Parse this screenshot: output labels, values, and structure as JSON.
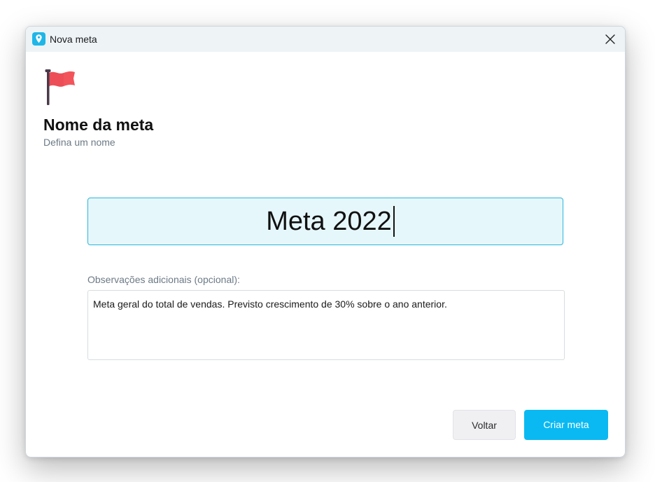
{
  "window": {
    "title": "Nova meta",
    "app_icon": "map-pin-icon",
    "close_icon": "close-icon"
  },
  "header": {
    "icon": "red-flag-icon",
    "title": "Nome da meta",
    "subtitle": "Defina um nome"
  },
  "form": {
    "goal_name_value": "Meta 2022",
    "notes_label": "Observações adicionais (opcional):",
    "notes_value": "Meta geral do total de vendas. Previsto crescimento de 30% sobre o ano anterior."
  },
  "actions": {
    "back_label": "Voltar",
    "create_label": "Criar meta"
  },
  "colors": {
    "accent": "#0ab9f2",
    "input_bg": "#e6f7fc",
    "input_border": "#2bb7d9",
    "flag": "#f2545b",
    "subtle_text": "#6c7a86"
  }
}
